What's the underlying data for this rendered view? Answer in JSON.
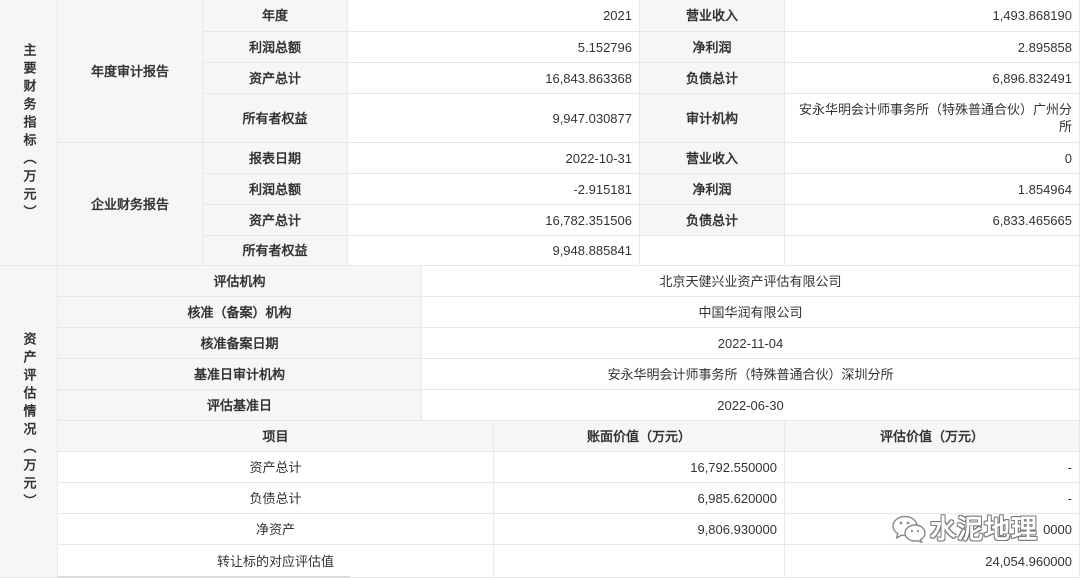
{
  "financial_indicators": {
    "section_label": "主要财务指标（万元）",
    "groups": [
      {
        "label": "年度审计报告",
        "rows": [
          {
            "label1": "年度",
            "value1": "2021",
            "label2": "营业收入",
            "value2": "1,493.868190"
          },
          {
            "label1": "利润总额",
            "value1": "5.152796",
            "label2": "净利润",
            "value2": "2.895858"
          },
          {
            "label1": "资产总计",
            "value1": "16,843.863368",
            "label2": "负债总计",
            "value2": "6,896.832491"
          },
          {
            "label1": "所有者权益",
            "value1": "9,947.030877",
            "label2": "审计机构",
            "value2": "安永华明会计师事务所（特殊普通合伙）广州分所"
          }
        ]
      },
      {
        "label": "企业财务报告",
        "rows": [
          {
            "label1": "报表日期",
            "value1": "2022-10-31",
            "label2": "营业收入",
            "value2": "0"
          },
          {
            "label1": "利润总额",
            "value1": "-2.915181",
            "label2": "净利润",
            "value2": "1.854964"
          },
          {
            "label1": "资产总计",
            "value1": "16,782.351506",
            "label2": "负债总计",
            "value2": "6,833.465665"
          },
          {
            "label1": "所有者权益",
            "value1": "9,948.885841",
            "label2": "",
            "value2": ""
          }
        ]
      }
    ]
  },
  "asset_appraisal": {
    "section_label": "资产评估情况（万元）",
    "info_rows": [
      {
        "label": "评估机构",
        "value": "北京天健兴业资产评估有限公司"
      },
      {
        "label": "核准（备案）机构",
        "value": "中国华润有限公司"
      },
      {
        "label": "核准备案日期",
        "value": "2022-11-04"
      },
      {
        "label": "基准日审计机构",
        "value": "安永华明会计师事务所（特殊普通合伙）深圳分所"
      },
      {
        "label": "评估基准日",
        "value": "2022-06-30"
      }
    ],
    "value_table": {
      "headers": {
        "item": "项目",
        "book_value": "账面价值（万元）",
        "appraised_value": "评估价值（万元）"
      },
      "rows": [
        {
          "item": "资产总计",
          "book_value": "16,792.550000",
          "appraised_value": "-"
        },
        {
          "item": "负债总计",
          "book_value": "6,985.620000",
          "appraised_value": "-"
        },
        {
          "item": "净资产",
          "book_value": "9,806.930000",
          "appraised_value": "0000"
        },
        {
          "item": "转让标的对应评估值",
          "book_value": "",
          "appraised_value": "24,054.960000"
        }
      ]
    }
  },
  "watermark": {
    "text": "水泥地理",
    "icon": "wechat-icon"
  },
  "colors": {
    "label_background": "#f6f6f6",
    "border": "#e8e8e8",
    "text": "#333333"
  }
}
